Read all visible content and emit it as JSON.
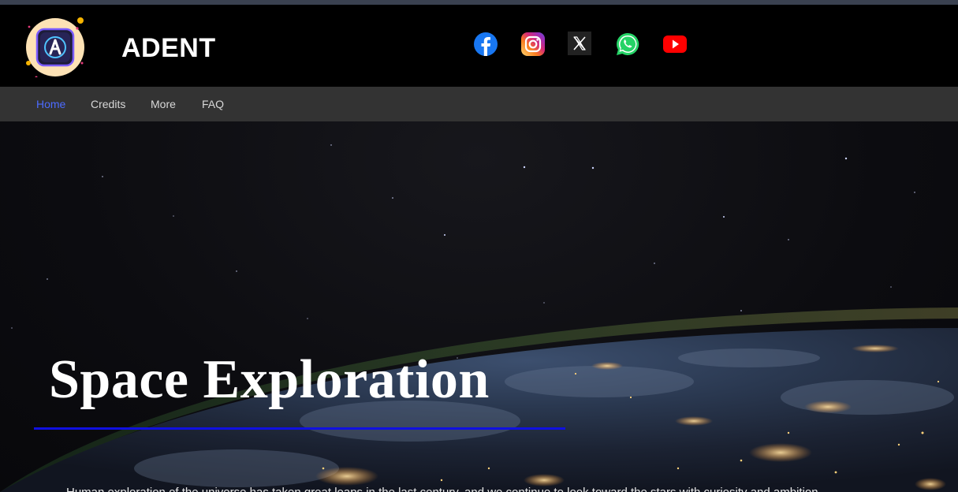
{
  "header": {
    "brand": "ADENT",
    "logo_icon": "adent-logo-icon",
    "social": [
      {
        "name": "facebook-icon",
        "color": "#1877f2"
      },
      {
        "name": "instagram-icon",
        "color": "#d62976"
      },
      {
        "name": "x-icon",
        "color": "#222222"
      },
      {
        "name": "whatsapp-icon",
        "color": "#25d366"
      },
      {
        "name": "youtube-icon",
        "color": "#ff0000"
      }
    ]
  },
  "nav": {
    "items": [
      {
        "label": "Home",
        "active": true
      },
      {
        "label": "Credits",
        "active": false
      },
      {
        "label": "More",
        "active": false
      },
      {
        "label": "FAQ",
        "active": false
      }
    ],
    "active_color": "#4c6bff"
  },
  "hero": {
    "title": "Space Exploration",
    "rule_color": "#1010e0",
    "intro": "Human exploration of the universe has taken great leaps in the last century, and we continue to look toward the stars with curiosity and ambition."
  }
}
